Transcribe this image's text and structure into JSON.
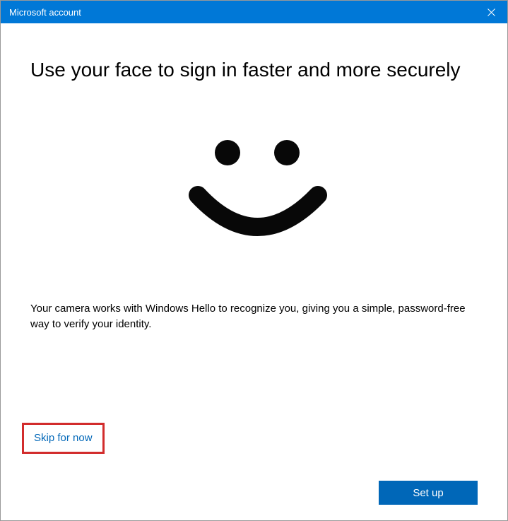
{
  "titlebar": {
    "title": "Microsoft account"
  },
  "content": {
    "heading": "Use your face to sign in faster and more securely",
    "description": "Your camera works with Windows Hello to recognize you, giving you a simple, password-free way to verify your identity."
  },
  "actions": {
    "skip_label": "Skip for now",
    "setup_label": "Set up"
  },
  "colors": {
    "primary": "#0078d7",
    "button": "#0067b8",
    "highlight_border": "#d22c2c"
  }
}
